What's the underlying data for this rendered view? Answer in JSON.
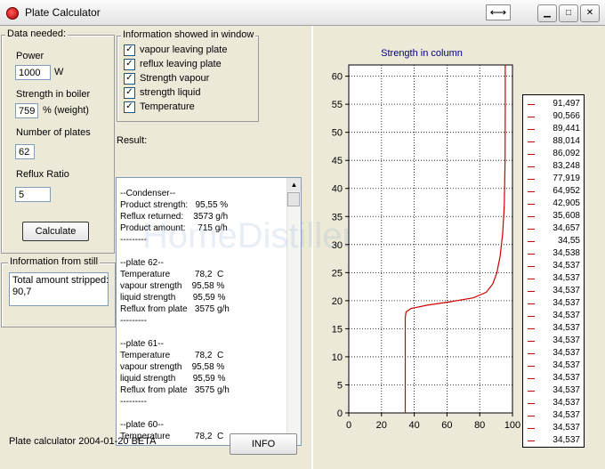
{
  "window": {
    "title": "Plate Calculator",
    "resize_glyph": "⟷"
  },
  "titlebar_buttons": [
    {
      "name": "minimize-button",
      "glyph": "▁",
      "icon": "minimize-icon"
    },
    {
      "name": "maximize-button",
      "glyph": "□",
      "icon": "maximize-icon"
    },
    {
      "name": "close-button",
      "glyph": "✕",
      "icon": "close-icon"
    }
  ],
  "data_needed": {
    "legend": "Data needed:",
    "power_label": "Power",
    "power_value": "1000",
    "power_unit": "W",
    "strength_label": "Strength in  boiler",
    "strength_value": "759",
    "strength_unit": "% (weight)",
    "plates_label": "Number of plates",
    "plates_value": "62",
    "reflux_label": "Reflux Ratio",
    "reflux_value": "5",
    "calculate_label": "Calculate"
  },
  "info_window": {
    "legend": "Information showed in window",
    "options": [
      {
        "label": "vapour leaving plate",
        "checked": true
      },
      {
        "label": "reflux leaving plate",
        "checked": true
      },
      {
        "label": "Strength vapour",
        "checked": true
      },
      {
        "label": "strength liquid",
        "checked": true
      },
      {
        "label": "Temperature",
        "checked": true
      }
    ]
  },
  "still_info": {
    "legend": "Information from still",
    "text": "Total amount stripped:\n90,7"
  },
  "result": {
    "label": "Result:",
    "text": "--Condenser--\nProduct strength:   95,55 %\nReflux returned:    3573 g/h\nProduct amount:     715 g/h\n---------\n\n--plate 62--\nTemperature          78,2  C\nvapour strength    95,58 %\nliquid strength       95,59 %\nReflux from plate   3575 g/h\n---------\n\n--plate 61--\nTemperature          78,2  C\nvapour strength    95,58 %\nliquid strength       95,59 %\nReflux from plate   3575 g/h\n---------\n\n--plate 60--\nTemperature          78,2  C"
  },
  "footer": {
    "version_text": "Plate calculator 2004-01-20 BETA",
    "info_label": "INFO"
  },
  "watermark": "HomeDistiller.ru",
  "colors": {
    "series": "#cc0000",
    "title": "#000080",
    "face": "#ece9d8"
  },
  "chart_data": {
    "type": "line",
    "title": "Strength in column",
    "xlabel": "",
    "ylabel": "",
    "xlim": [
      0,
      100
    ],
    "ylim": [
      0,
      62
    ],
    "x_ticks": [
      0,
      20,
      40,
      60,
      80,
      100
    ],
    "y_ticks": [
      0,
      5,
      10,
      15,
      20,
      25,
      30,
      35,
      40,
      45,
      50,
      55,
      60
    ],
    "grid": true,
    "series": [
      {
        "points": [
          {
            "x": 34.5,
            "y": 0
          },
          {
            "x": 34.5,
            "y": 17
          },
          {
            "x": 35,
            "y": 18
          },
          {
            "x": 38,
            "y": 18.6
          },
          {
            "x": 48,
            "y": 19.2
          },
          {
            "x": 62,
            "y": 19.8
          },
          {
            "x": 76,
            "y": 20.5
          },
          {
            "x": 84,
            "y": 21.5
          },
          {
            "x": 88,
            "y": 23
          },
          {
            "x": 90.5,
            "y": 25
          },
          {
            "x": 92.5,
            "y": 28
          },
          {
            "x": 94,
            "y": 32
          },
          {
            "x": 95,
            "y": 37
          },
          {
            "x": 95.5,
            "y": 45
          },
          {
            "x": 95.6,
            "y": 55
          },
          {
            "x": 95.6,
            "y": 62
          }
        ]
      }
    ],
    "legend_entries": [
      "91,497",
      "90,566",
      "89,441",
      "88,014",
      "86,092",
      "83,248",
      "77,919",
      "64,952",
      "42,905",
      "35,608",
      "34,657",
      "34,55",
      "34,538",
      "34,537",
      "34,537",
      "34,537",
      "34,537",
      "34,537",
      "34,537",
      "34,537",
      "34,537",
      "34,537",
      "34,537",
      "34,537",
      "34,537",
      "34,537",
      "34,537",
      "34,537"
    ]
  }
}
